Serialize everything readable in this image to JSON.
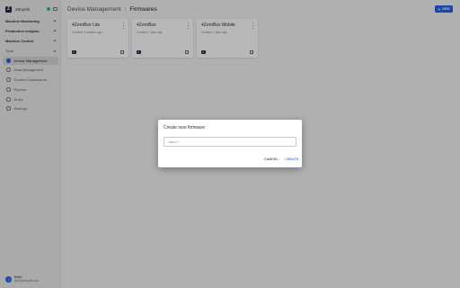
{
  "sidebar": {
    "brand_name": "Zenynth",
    "brand_logo_letter": "Z",
    "groups": [
      {
        "label": "Machine Monitoring"
      },
      {
        "label": "Production Insights"
      },
      {
        "label": "Machine Control"
      },
      {
        "label": "Tools"
      }
    ],
    "items": [
      {
        "label": "Device Management",
        "icon": "device-icon",
        "active": true
      },
      {
        "label": "Data Management",
        "icon": "database-icon"
      },
      {
        "label": "Custom Dashboards",
        "icon": "dashboard-icon"
      },
      {
        "label": "Reports",
        "icon": "report-icon"
      },
      {
        "label": "Rules",
        "icon": "rules-icon"
      },
      {
        "label": "Settings",
        "icon": "gear-icon"
      }
    ],
    "user": {
      "initial": "J",
      "name": "Bobb",
      "email": "jbob@zenynth.com"
    }
  },
  "header": {
    "breadcrumb_parent": "Device Management",
    "breadcrumb_separator": "/",
    "breadcrumb_current": "Firmwares",
    "new_button_label": "NEW",
    "new_button_icon": "+"
  },
  "cards": [
    {
      "title": "4ZeroBox Lite",
      "meta": "Created 3 months ago",
      "badge": "Z"
    },
    {
      "title": "4ZeroBox",
      "meta": "Created 1 year ago",
      "badge": "Z"
    },
    {
      "title": "4ZeroBox Mobile",
      "meta": "Created 1 year ago",
      "badge": "Z"
    }
  ],
  "dialog": {
    "title": "Create new firmware",
    "input_placeholder": "Name *",
    "input_value": "",
    "cancel_label": "CANCEL",
    "create_label": "CREATE"
  },
  "colors": {
    "accent": "#2563eb",
    "status_online": "#22c55e",
    "brand_dark": "#1f2a44"
  }
}
